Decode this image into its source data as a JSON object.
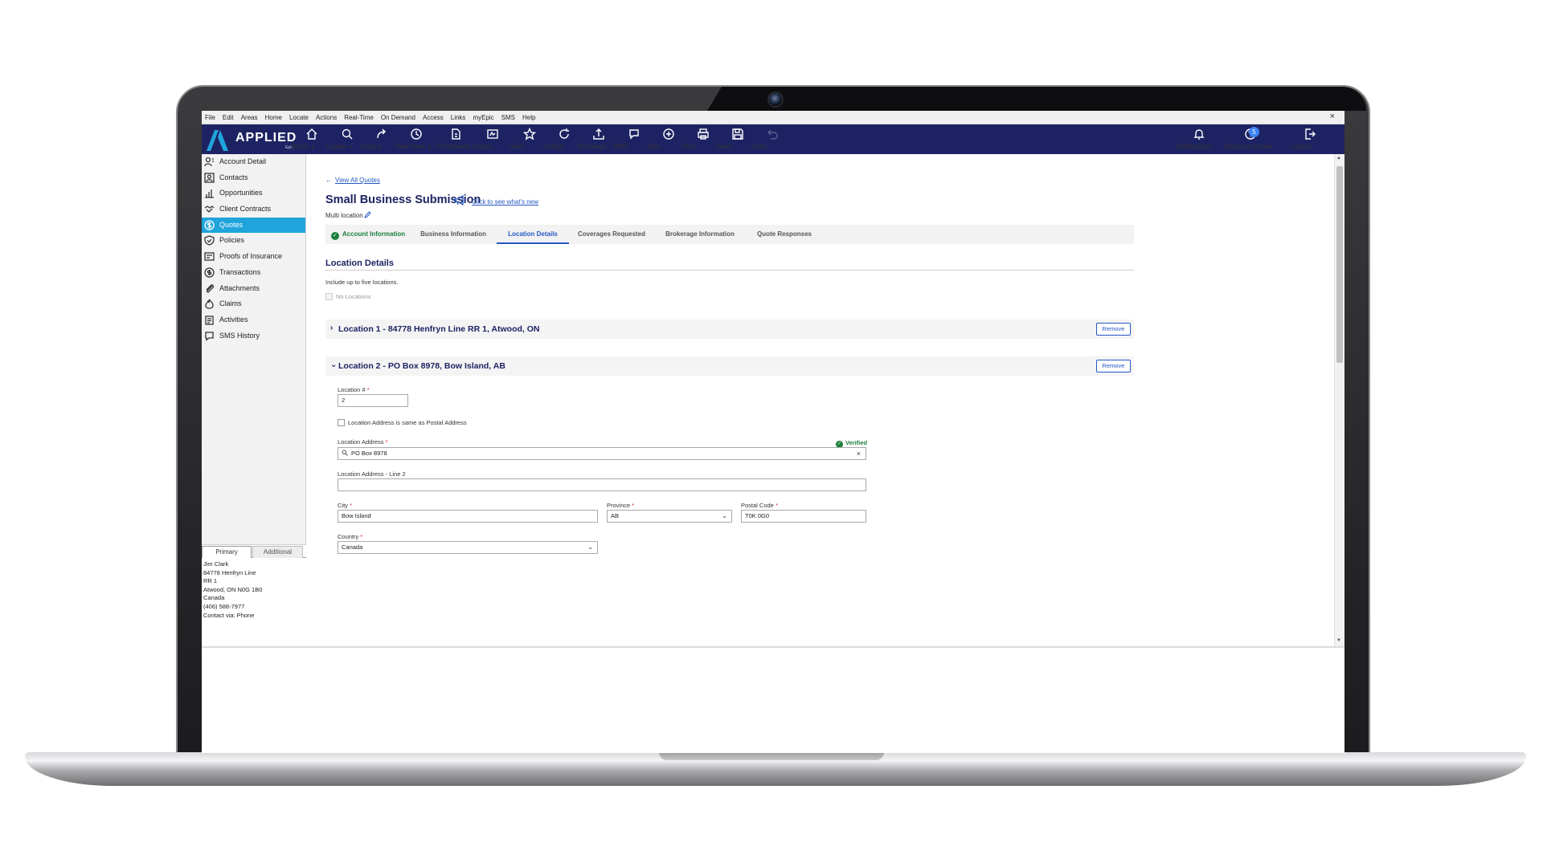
{
  "menubar": {
    "items": [
      "File",
      "Edit",
      "Areas",
      "Home",
      "Locate",
      "Actions",
      "Real-Time",
      "On Demand",
      "Access",
      "Links",
      "myEpic",
      "SMS",
      "Help"
    ],
    "close": "×"
  },
  "logo": {
    "brand": "APPLIED",
    "sub": "Epic"
  },
  "toolbar": {
    "home": "Home",
    "locate": "Locate",
    "actions": "Actions",
    "realtime": "Real-Time",
    "ondemand": "On Demand",
    "access": "Access",
    "links": "Links",
    "myepic": "myEpic",
    "exchange": "Exchange",
    "sms": "SMS",
    "new": "New",
    "print": "Print",
    "save": "Save",
    "undo": "Undo",
    "notifications": "Notifications",
    "resource_center": "Resource Center",
    "resource_badge": "5",
    "logout": "Logout"
  },
  "sidebar": {
    "items": [
      "Account Detail",
      "Contacts",
      "Opportunities",
      "Client Contracts",
      "Quotes",
      "Policies",
      "Proofs of Insurance",
      "Transactions",
      "Attachments",
      "Claims",
      "Activities",
      "SMS History"
    ],
    "active": "Quotes"
  },
  "contact": {
    "tab_primary": "Primary",
    "tab_additional": "Additional",
    "lines": [
      "Jim Clark",
      "84778 Henfryn Line",
      "RR 1",
      "Atwood, ON  N0G 1B0",
      "Canada",
      "(406) 588-7977",
      "Contact via: Phone"
    ]
  },
  "main": {
    "back_link": "View All Quotes",
    "title": "Small Business Submission",
    "whats_new": "Click to see what's new",
    "subtitle": "Multi location",
    "tabs": [
      "Account Information",
      "Business Information",
      "Location Details",
      "Coverages Requested",
      "Brokerage Information",
      "Quote Responses"
    ],
    "active_tab": "Location Details",
    "section_title": "Location Details",
    "section_desc": "Include up to five locations.",
    "no_locations": "No Locations",
    "remove_label": "Remove",
    "location1_title": "Location 1 - 84778 Henfryn Line RR 1, Atwood, ON",
    "location2_title": "Location 2 - PO Box 8978, Bow Island, AB"
  },
  "form": {
    "location_num_label": "Location #",
    "location_num_value": "2",
    "same_as_postal": "Location Address is same as Postal Address",
    "address_label": "Location Address",
    "verified": "Verified",
    "address_value": "PO Box 8978",
    "address2_label": "Location Address - Line 2",
    "address2_value": "",
    "city_label": "City",
    "city_value": "Bow Island",
    "province_label": "Province",
    "province_value": "AB",
    "postal_label": "Postal Code",
    "postal_value": "T0K 0G0",
    "country_label": "Country",
    "country_value": "Canada"
  },
  "colors": {
    "toolbar": "#1d2362",
    "accent": "#2457c5",
    "active_nav": "#20a4dc",
    "verified": "#1a7f3c"
  }
}
